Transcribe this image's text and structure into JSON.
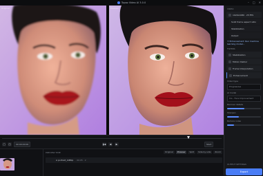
{
  "app": {
    "title": "Topaz Video AI 3.0.0"
  },
  "window_controls": [
    "–",
    "□",
    "✕"
  ],
  "viewer": {
    "left_label": "Original",
    "right_label": "Preview"
  },
  "panel": {
    "sections": [
      {
        "title": "VIDEO",
        "rows": [
          {
            "label": "1920x1080 · 25 FPS",
            "inset": false,
            "selected": false
          },
          {
            "label": "Solid frame aspect ratio",
            "inset": true,
            "selected": false
          },
          {
            "label": "Stabilization",
            "inset": true,
            "selected": false
          },
          {
            "label": "Output",
            "inset": true,
            "selected": false
          }
        ]
      },
      {
        "title": "FILTERS",
        "rows": [
          {
            "label": "Stabilization",
            "inset": false,
            "selected": false
          },
          {
            "label": "Motion Deblur",
            "inset": false,
            "selected": false
          },
          {
            "label": "Frame Interpolation",
            "inset": false,
            "selected": false
          },
          {
            "label": "Enhancement",
            "inset": false,
            "selected": true
          }
        ]
      }
    ],
    "highlight_text": "✦ Enhancement: Run machine learning model...",
    "fields": [
      {
        "label": "Video type",
        "value": "Progressive"
      },
      {
        "label": "AI model",
        "value": "Iris - Face Improvement"
      },
      {
        "label": "Recover details",
        "value": ""
      },
      {
        "label": "Sharpen",
        "value": ""
      },
      {
        "label": "Reduce noise",
        "value": ""
      }
    ],
    "slider_levels": [
      0.5,
      0.35,
      0.2
    ],
    "output_settings": "OUTPUT SETTINGS",
    "export_label": "Export"
  },
  "transport": {
    "timecode": "00:00:00:00",
    "playhead_fraction": 0.85,
    "start_label": "Start Frame",
    "buttons": [
      "▮◀",
      "◀",
      "▶"
    ],
    "right_chip": "Start"
  },
  "bottom": {
    "header": "PREVIEW TIME",
    "tabs": [
      {
        "label": "Original",
        "on": false
      },
      {
        "label": "Preview",
        "on": true
      },
      {
        "label": "Split",
        "on": false
      },
      {
        "label": "Side by side",
        "on": false
      },
      {
        "label": "Zoom",
        "on": false
      }
    ],
    "clip_name": "A portrait_1080p",
    "clip_meta": "·  00:05  ·  2"
  }
}
